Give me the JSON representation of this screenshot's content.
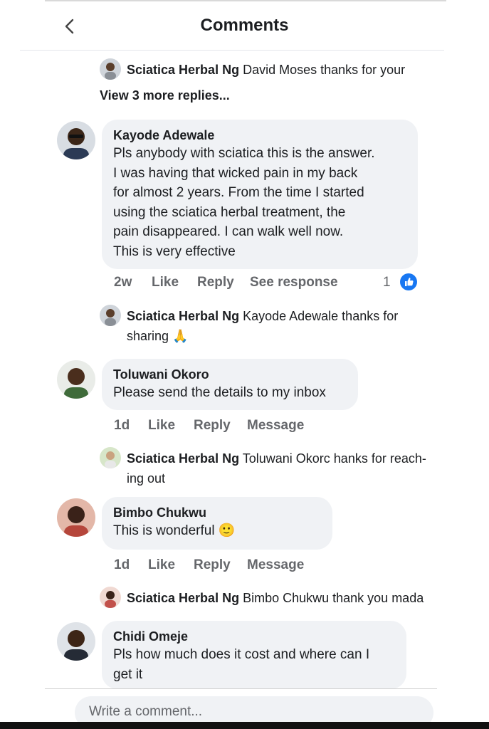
{
  "header": {
    "title": "Comments"
  },
  "comments": [
    {
      "reply": {
        "author": "Sciatica Herbal Ng",
        "text": "David Moses thanks for your"
      },
      "view_more": "View 3 more replies..."
    },
    {
      "author": "Kayode Adewale",
      "text": "Pls anybody with sciatica this is the answer.\nI was having that wicked pain in my back\nfor almost 2 years. From the time I started\nusing the sciatica herbal treatment, the\npain disappeared. I can walk well now.\nThis is very effective",
      "time": "2w",
      "actions": [
        "Like",
        "Reply",
        "See response"
      ],
      "like_count": "1",
      "reply": {
        "author": "Sciatica Herbal Ng",
        "text": "Kayode Adewale thanks for sharing 🙏"
      }
    },
    {
      "author": "Toluwani Okoro",
      "text": "Please send the details to my inbox",
      "time": "1d",
      "actions": [
        "Like",
        "Reply",
        "Message"
      ],
      "reply": {
        "author": "Sciatica Herbal Ng",
        "text": "Toluwani Okorc hanks for reach-ing out"
      }
    },
    {
      "author": "Bimbo Chukwu",
      "text": "This is wonderful 🙂",
      "time": "1d",
      "actions": [
        "Like",
        "Reply",
        "Message"
      ],
      "reply": {
        "author": "Sciatica Herbal Ng",
        "text": "Bimbo Chukwu thank you mada"
      }
    },
    {
      "author": "Chidi Omeje",
      "text": "Pls how much does it cost and where can I\nget it"
    }
  ],
  "composer": {
    "placeholder": "Write a comment..."
  },
  "colors": {
    "like_blue": "#1877f2",
    "bubble_bg": "#f0f2f5",
    "meta_gray": "#65676b"
  },
  "icons": [
    "back-chevron-icon",
    "like-thumb-icon",
    "avatar"
  ]
}
